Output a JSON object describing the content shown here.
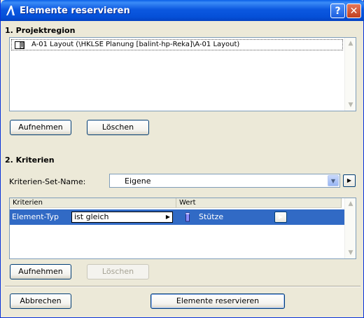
{
  "window": {
    "title": "Elemente reservieren"
  },
  "section1": {
    "heading": "1. Projektregion",
    "items": [
      {
        "label": "A-01 Layout (\\HKLSE Planung  [balint-hp-Reka]\\A-01 Layout)",
        "icon": "layout-sheet-icon"
      }
    ],
    "add_button": "Aufnehmen",
    "delete_button": "Löschen"
  },
  "section2": {
    "heading": "2. Kriterien",
    "set_name_label": "Kriterien-Set-Name:",
    "set_name_value": "Eigene",
    "table": {
      "columns": [
        "Kriterien",
        "Wert"
      ],
      "rows": [
        {
          "criterion": "Element-Typ",
          "operator": "ist gleich",
          "value": "Stütze",
          "icon": "column-element-icon"
        }
      ]
    },
    "add_button": "Aufnehmen",
    "delete_button": "Löschen"
  },
  "footer": {
    "cancel_button": "Abbrechen",
    "reserve_button": "Elemente reservieren"
  },
  "colors": {
    "selection": "#316ac5",
    "titlebar": "#0550d8",
    "face": "#ece9d8"
  }
}
